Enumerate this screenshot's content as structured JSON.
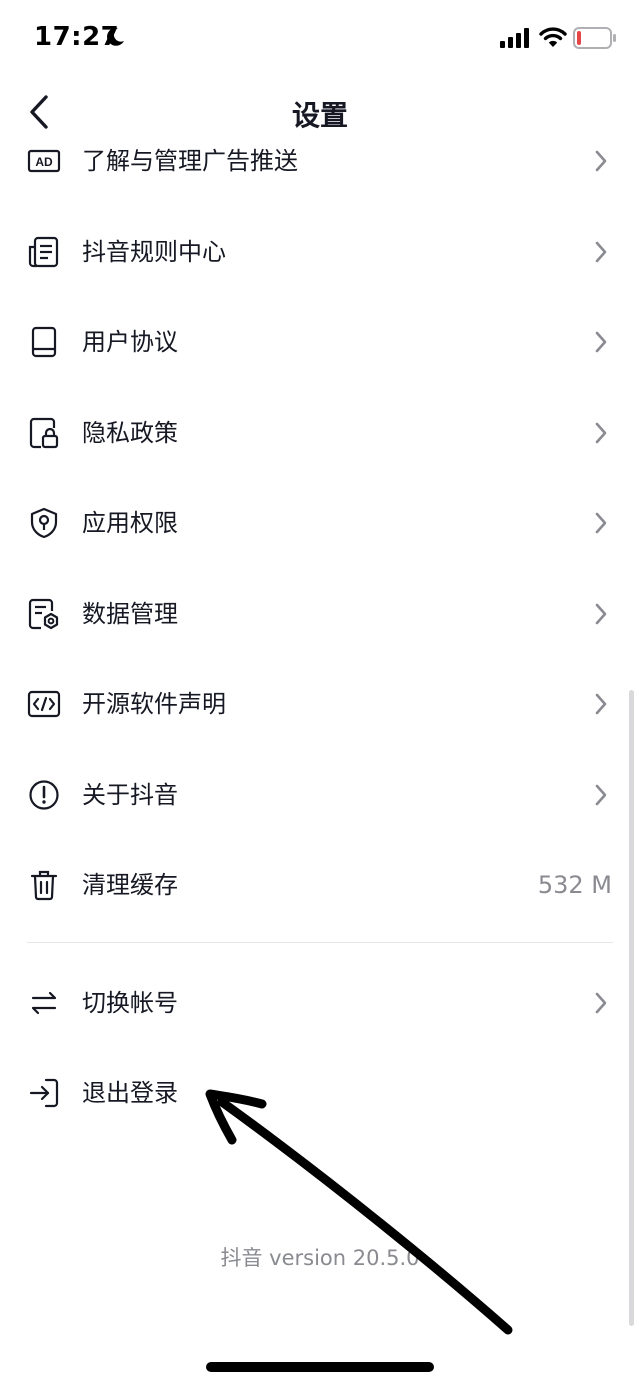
{
  "status_bar": {
    "time": "17:27",
    "moon_icon": "moon-icon",
    "signal_icon": "cellular-signal-icon",
    "wifi_icon": "wifi-icon",
    "battery_icon": "battery-low-icon",
    "battery_level_color": "#e64545"
  },
  "nav": {
    "back_icon": "chevron-left-icon",
    "title": "设置"
  },
  "settings": {
    "items": [
      {
        "label": "了解与管理广告推送",
        "icon": "ad-icon",
        "trailing": "chevron"
      },
      {
        "label": "抖音规则中心",
        "icon": "document-list-icon",
        "trailing": "chevron"
      },
      {
        "label": "用户协议",
        "icon": "book-icon",
        "trailing": "chevron"
      },
      {
        "label": "隐私政策",
        "icon": "document-lock-icon",
        "trailing": "chevron"
      },
      {
        "label": "应用权限",
        "icon": "shield-key-icon",
        "trailing": "chevron"
      },
      {
        "label": "数据管理",
        "icon": "document-gear-icon",
        "trailing": "chevron"
      },
      {
        "label": "开源软件声明",
        "icon": "code-icon",
        "trailing": "chevron"
      },
      {
        "label": "关于抖音",
        "icon": "info-exclamation-icon",
        "trailing": "chevron"
      },
      {
        "label": "清理缓存",
        "icon": "trash-icon",
        "trailing": "value",
        "value": "532 M"
      }
    ],
    "account_items": [
      {
        "label": "切换帐号",
        "icon": "switch-arrows-icon",
        "trailing": "chevron"
      },
      {
        "label": "退出登录",
        "icon": "logout-icon",
        "trailing": "none"
      }
    ]
  },
  "footer": {
    "version": "抖音 version 20.5.0"
  },
  "colors": {
    "text_primary": "#161823",
    "text_secondary": "#8a8b91",
    "divider": "#e6e6e8",
    "annotation": "#000000"
  },
  "annotation": {
    "arrow_icon": "hand-drawn-arrow-icon"
  }
}
